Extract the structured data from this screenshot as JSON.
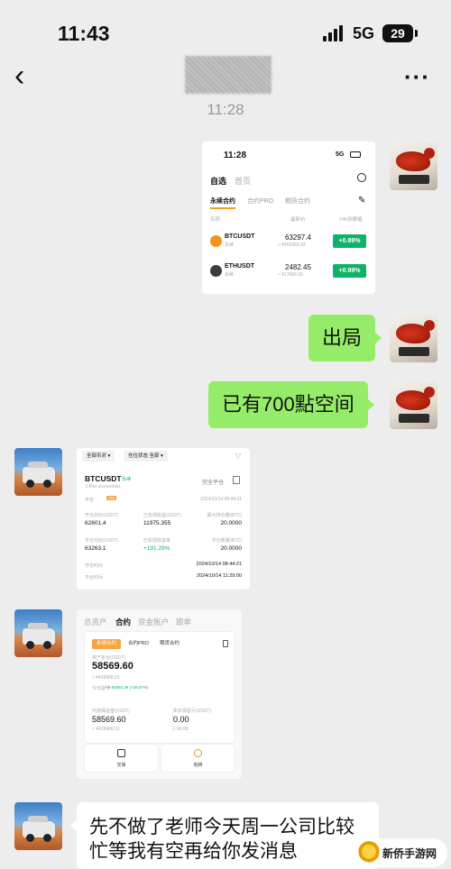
{
  "status_bar": {
    "time": "11:43",
    "network": "5G",
    "battery": "29"
  },
  "nav": {
    "title": ""
  },
  "timestamp": "11:28",
  "messages": [
    {
      "type": "screenshot",
      "side": "right",
      "content": {
        "time": "11:28",
        "network": "5G",
        "tabs": [
          "自选",
          "首页"
        ],
        "sub_tabs": [
          "永续合约",
          "合约PRO",
          "期货合约"
        ],
        "columns": [
          "名称",
          "最新价",
          "24h涨跌幅"
        ],
        "rows": [
          {
            "symbol": "BTCUSDT",
            "sub": "永续",
            "price": "63297.4",
            "price_sub": "≈ ¥452066.33",
            "change": "+0.89%",
            "coin_color": "#f7931a"
          },
          {
            "symbol": "ETHUSDT",
            "sub": "永续",
            "price": "2482.45",
            "price_sub": "≈ ¥17666.66",
            "change": "+0.99%",
            "coin_color": "#3c3c3d"
          }
        ]
      }
    },
    {
      "type": "text",
      "side": "right",
      "text": "出局"
    },
    {
      "type": "text",
      "side": "right",
      "text": "已有700點空间"
    },
    {
      "type": "screenshot",
      "side": "left",
      "content": {
        "filters": [
          "全部币对 ▾",
          "仓位状态 全部 ▾"
        ],
        "pair": "BTCUSDT",
        "pair_tag": "永续",
        "share_label": "完全平仓",
        "order_id": "订单ID 2519293281",
        "side_label": "平空",
        "leverage": "20x",
        "open_time_top": "2024/10/14 08:44:21",
        "fields": [
          {
            "label": "开仓均价(USDT)",
            "value": "62601.4"
          },
          {
            "label": "已实现收益(USDT)",
            "value": "11975.355"
          },
          {
            "label": "最大持仓量(BTC)",
            "value": "20.0000"
          },
          {
            "label": "平仓均价(USDT)",
            "value": "63263.1"
          },
          {
            "label": "已实现收益率",
            "value": "+191.29%"
          },
          {
            "label": "平仓数量(BTC)",
            "value": "20.0000"
          }
        ],
        "open_time_label": "开仓时间",
        "open_time": "2024/10/14 08:44:21",
        "close_time_label": "平仓时间",
        "close_time": "2024/10/14 11:29:00"
      }
    },
    {
      "type": "screenshot",
      "side": "left",
      "content": {
        "top_tabs": [
          "总资产",
          "合约",
          "资金账户",
          "跟单"
        ],
        "pills": [
          "永续合约",
          "合约PRO",
          "期货合约"
        ],
        "equity_label": "资产折合(USDT)",
        "equity": "58569.60",
        "equity_sub": "≈ ¥418468.31",
        "pnl_label": "今日盈亏",
        "pnl": "+ ¥ 83084.38 (+36.57%)",
        "available_label": "可用保证金(USDT)",
        "available": "58569.60",
        "available_sub": "≈ ¥418468.31",
        "unrealized_label": "未实现盈亏(USDT)",
        "unrealized": "0.00",
        "unrealized_sub": "≈ ¥0.00",
        "actions": [
          "交易",
          "划转"
        ]
      }
    },
    {
      "type": "text",
      "side": "left",
      "text": "先不做了老师今天周一公司比较忙等我有空再给你发消息"
    }
  ],
  "watermark": {
    "text": "新侨手游网"
  }
}
